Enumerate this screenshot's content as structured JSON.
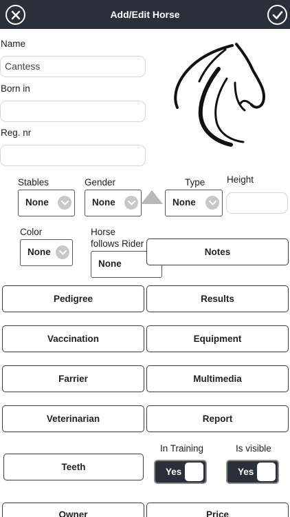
{
  "header": {
    "title": "Add/Edit Horse"
  },
  "form": {
    "name_label": "Name",
    "name_value": "Cantess",
    "born_label": "Born in",
    "born_value": "",
    "reg_label": "Reg. nr",
    "reg_value": ""
  },
  "selects": {
    "stables_label": "Stables",
    "stables_value": "None",
    "gender_label": "Gender",
    "gender_value": "None",
    "type_label": "Type",
    "type_value": "None",
    "height_label": "Height",
    "height_value": "",
    "color_label": "Color",
    "color_value": "None",
    "follows_label_line1": "Horse",
    "follows_label_line2": "follows Rider",
    "follows_value": "None"
  },
  "buttons": {
    "notes": "Notes",
    "pedigree": "Pedigree",
    "results": "Results",
    "vaccination": "Vaccination",
    "equipment": "Equipment",
    "farrier": "Farrier",
    "multimedia": "Multimedia",
    "veterinarian": "Veterinarian",
    "report": "Report",
    "teeth": "Teeth",
    "owner": "Owner",
    "price": "Price"
  },
  "toggles": {
    "in_training_label": "In Training",
    "in_training_value": "Yes",
    "is_visible_label": "Is visible",
    "is_visible_value": "Yes"
  },
  "icons": {
    "close": "close-circle-icon",
    "confirm": "checkmark-circle-icon",
    "logo": "horse-head-logo",
    "chevron": "chevron-down-icon"
  },
  "colors": {
    "header_bg": "#2b2f3a",
    "toggle_bg": "#2b2f3a",
    "accent_text": "#ffffff"
  }
}
